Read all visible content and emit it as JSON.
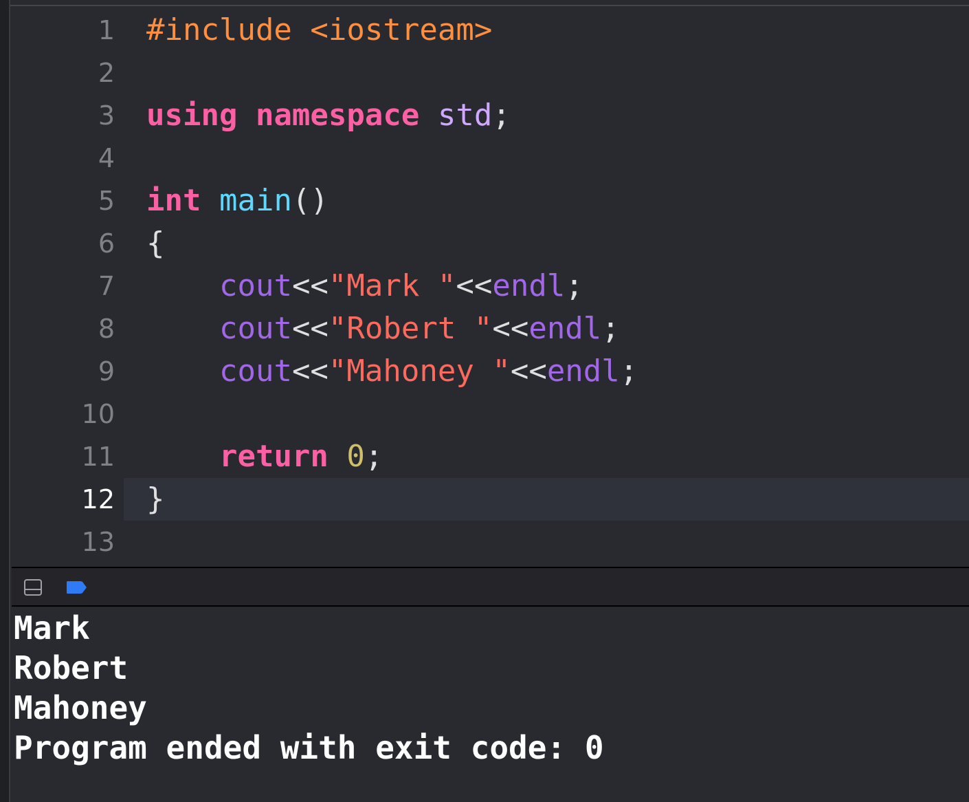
{
  "editor": {
    "line_numbers": [
      "1",
      "2",
      "3",
      "4",
      "5",
      "6",
      "7",
      "8",
      "9",
      "10",
      "11",
      "12",
      "13"
    ],
    "current_line": "12",
    "lines": [
      [
        {
          "t": "#include <iostream>",
          "c": "preproc"
        }
      ],
      [],
      [
        {
          "t": "using",
          "c": "kw"
        },
        {
          "t": " ",
          "c": "plain"
        },
        {
          "t": "namespace",
          "c": "kw"
        },
        {
          "t": " ",
          "c": "plain"
        },
        {
          "t": "std",
          "c": "ns"
        },
        {
          "t": ";",
          "c": "plain"
        }
      ],
      [],
      [
        {
          "t": "int",
          "c": "kw"
        },
        {
          "t": " ",
          "c": "plain"
        },
        {
          "t": "main",
          "c": "fnname"
        },
        {
          "t": "()",
          "c": "plain"
        }
      ],
      [
        {
          "t": "{",
          "c": "plain"
        }
      ],
      [
        {
          "t": "    ",
          "c": "plain"
        },
        {
          "t": "cout",
          "c": "lib"
        },
        {
          "t": "<<",
          "c": "plain"
        },
        {
          "t": "\"Mark \"",
          "c": "str"
        },
        {
          "t": "<<",
          "c": "plain"
        },
        {
          "t": "endl",
          "c": "lib"
        },
        {
          "t": ";",
          "c": "plain"
        }
      ],
      [
        {
          "t": "    ",
          "c": "plain"
        },
        {
          "t": "cout",
          "c": "lib"
        },
        {
          "t": "<<",
          "c": "plain"
        },
        {
          "t": "\"Robert \"",
          "c": "str"
        },
        {
          "t": "<<",
          "c": "plain"
        },
        {
          "t": "endl",
          "c": "lib"
        },
        {
          "t": ";",
          "c": "plain"
        }
      ],
      [
        {
          "t": "    ",
          "c": "plain"
        },
        {
          "t": "cout",
          "c": "lib"
        },
        {
          "t": "<<",
          "c": "plain"
        },
        {
          "t": "\"Mahoney \"",
          "c": "str"
        },
        {
          "t": "<<",
          "c": "plain"
        },
        {
          "t": "endl",
          "c": "lib"
        },
        {
          "t": ";",
          "c": "plain"
        }
      ],
      [],
      [
        {
          "t": "    ",
          "c": "plain"
        },
        {
          "t": "return",
          "c": "kw"
        },
        {
          "t": " ",
          "c": "plain"
        },
        {
          "t": "0",
          "c": "num"
        },
        {
          "t": ";",
          "c": "plain"
        }
      ],
      [
        {
          "t": "}",
          "c": "plain"
        }
      ],
      []
    ]
  },
  "console_toolbar": {
    "toggle_icon": "panel-toggle-icon",
    "run_icon": "run-indicator-icon",
    "accent_color": "#2f7bf5"
  },
  "console": {
    "output_lines": [
      "Mark",
      "Robert",
      "Mahoney",
      "Program ended with exit code: 0"
    ]
  }
}
